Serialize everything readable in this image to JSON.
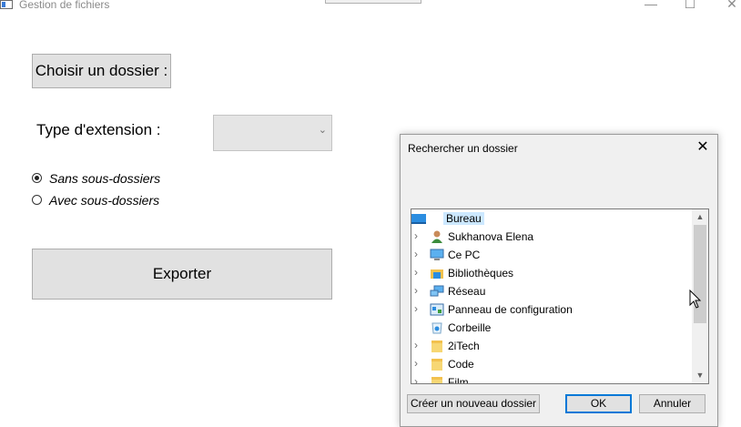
{
  "window": {
    "title": "Gestion de fichiers",
    "minimize_glyph": "—",
    "maximize_glyph": "☐",
    "close_glyph": "✕"
  },
  "form": {
    "choose_folder_button": "Choisir un dossier :",
    "extension_label": "Type d'extension :",
    "extension_value": "",
    "combo_arrow": "⌄",
    "radio_without_subfolders": "Sans sous-dossiers",
    "radio_with_subfolders": "Avec sous-dossiers",
    "radio_selected": "Sans sous-dossiers",
    "export_button": "Exporter"
  },
  "dialog": {
    "title": "Rechercher un dossier",
    "close_glyph": "✕",
    "tree_items": [
      {
        "label": "Bureau",
        "icon": "desktop-icon",
        "expandable": false,
        "selected": true
      },
      {
        "label": "Sukhanova Elena",
        "icon": "user-icon",
        "expandable": true
      },
      {
        "label": "Ce PC",
        "icon": "computer-icon",
        "expandable": true
      },
      {
        "label": "Bibliothèques",
        "icon": "library-icon",
        "expandable": true
      },
      {
        "label": "Réseau",
        "icon": "network-icon",
        "expandable": true
      },
      {
        "label": "Panneau de configuration",
        "icon": "control-panel-icon",
        "expandable": true
      },
      {
        "label": "Corbeille",
        "icon": "recycle-bin-icon",
        "expandable": false
      },
      {
        "label": "2iTech",
        "icon": "folder-icon",
        "expandable": true
      },
      {
        "label": "Code",
        "icon": "folder-icon",
        "expandable": true
      },
      {
        "label": "Film",
        "icon": "folder-icon",
        "expandable": true
      }
    ],
    "expand_glyph": "›",
    "scroll_up_glyph": "▲",
    "scroll_down_glyph": "▼",
    "new_folder_button": "Créer un nouveau dossier",
    "ok_button": "OK",
    "cancel_button": "Annuler"
  },
  "colors": {
    "selection": "#cce8ff",
    "default_button_border": "#0078d7",
    "button_face": "#e1e1e1",
    "dialog_face": "#f0f0f0"
  }
}
